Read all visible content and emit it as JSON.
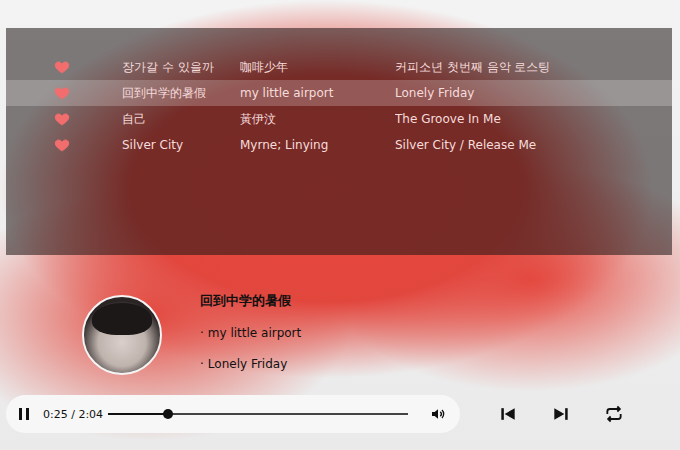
{
  "playlist": {
    "tracks": [
      {
        "title": "장가갈 수 있을까",
        "artist": "咖啡少年",
        "album": "커피소년 첫번째 음악 로스팅",
        "liked": true,
        "selected": false
      },
      {
        "title": "回到中学的暑假",
        "artist": "my little airport",
        "album": "Lonely Friday",
        "liked": true,
        "selected": true
      },
      {
        "title": "自己",
        "artist": "黃伊汶",
        "album": "The Groove In Me",
        "liked": true,
        "selected": false
      },
      {
        "title": "Silver City",
        "artist": "Myrne; Linying",
        "album": "Silver City / Release Me",
        "liked": true,
        "selected": false
      }
    ]
  },
  "now_playing": {
    "title": "回到中学的暑假",
    "bullet": "·",
    "artist": "my little airport",
    "album": "Lonely Friday"
  },
  "player": {
    "playing": true,
    "time": "0:25 / 2:04",
    "level": 0.2
  }
}
